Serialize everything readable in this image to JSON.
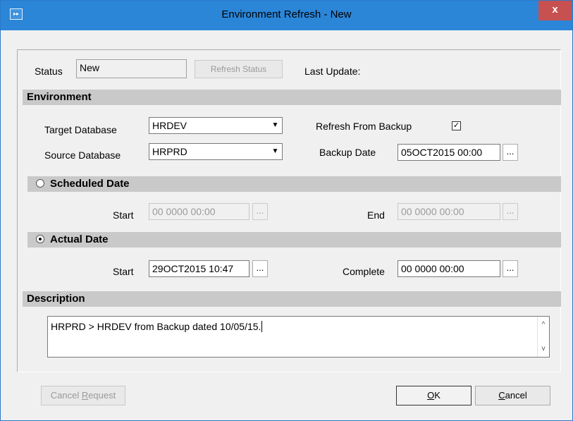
{
  "window": {
    "title": "Environment Refresh - New",
    "close_label": "x",
    "icon": "app-icon"
  },
  "status": {
    "label": "Status",
    "value": "New",
    "refresh_button": "Refresh Status",
    "last_update_label": "Last Update:"
  },
  "environment": {
    "header": "Environment",
    "target_label": "Target Database",
    "target_value": "HRDEV",
    "source_label": "Source Database",
    "source_value": "HRPRD",
    "refresh_from_backup_label": "Refresh From Backup",
    "refresh_from_backup_checked": true,
    "backup_date_label": "Backup Date",
    "backup_date_value": "05OCT2015 00:00"
  },
  "scheduled": {
    "header": "Scheduled Date",
    "selected": false,
    "start_label": "Start",
    "start_value": "00  0000 00:00",
    "end_label": "End",
    "end_value": "00  0000 00:00"
  },
  "actual": {
    "header": "Actual Date",
    "selected": true,
    "start_label": "Start",
    "start_value": "29OCT2015 10:47",
    "complete_label": "Complete",
    "complete_value": "00  0000 00:00"
  },
  "description": {
    "header": "Description",
    "text": "HRPRD > HRDEV from Backup dated 10/05/15."
  },
  "buttons": {
    "cancel_request_prefix": "Cancel ",
    "cancel_request_mnemonic": "R",
    "cancel_request_suffix": "equest",
    "ok_mnemonic": "O",
    "ok_suffix": "K",
    "cancel_mnemonic": "C",
    "cancel_suffix": "ancel"
  },
  "ellipsis": "...",
  "colors": {
    "titlebar": "#2b86d8",
    "close": "#c75050",
    "section": "#c9c9c9"
  }
}
